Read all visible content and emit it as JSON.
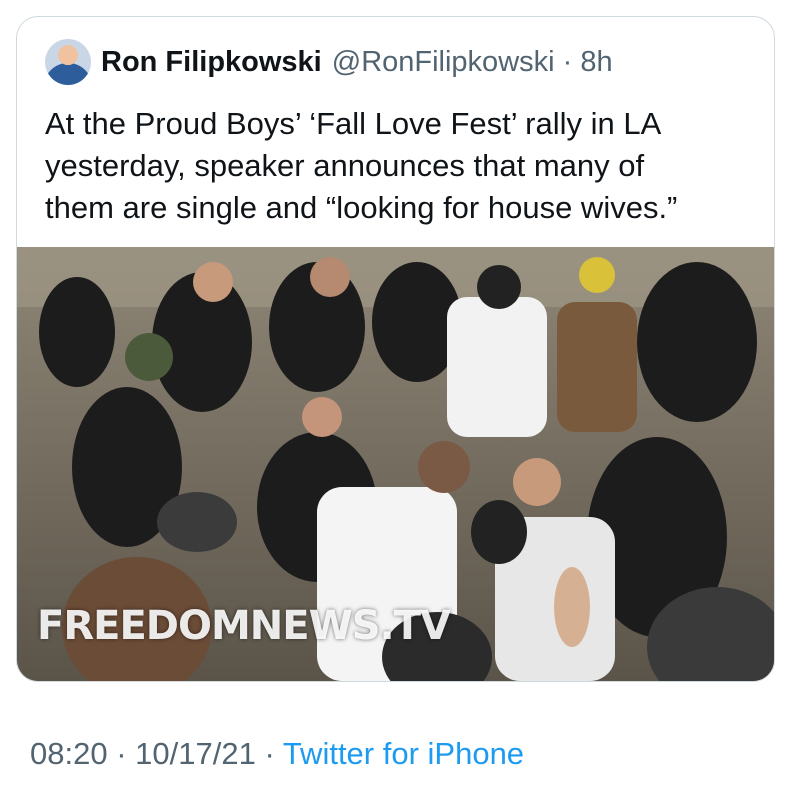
{
  "tweet": {
    "author_name": "Ron Filipkowski",
    "author_handle": "@RonFilipkowski",
    "separator": "·",
    "age": "8h",
    "text": "At the Proud Boys’ ‘Fall Love Fest’ rally in LA\nyesterday, speaker announces that many of\nthem are single and “looking for house wives.”",
    "media_watermark": "FREEDOMNEWS.TV",
    "time": "08:20",
    "date": "10/17/21",
    "source": "Twitter for iPhone"
  },
  "colors": {
    "link": "#1d9bf0",
    "secondary_text": "#536471",
    "border": "#cfd9de"
  },
  "icons": [
    "avatar-photo"
  ]
}
